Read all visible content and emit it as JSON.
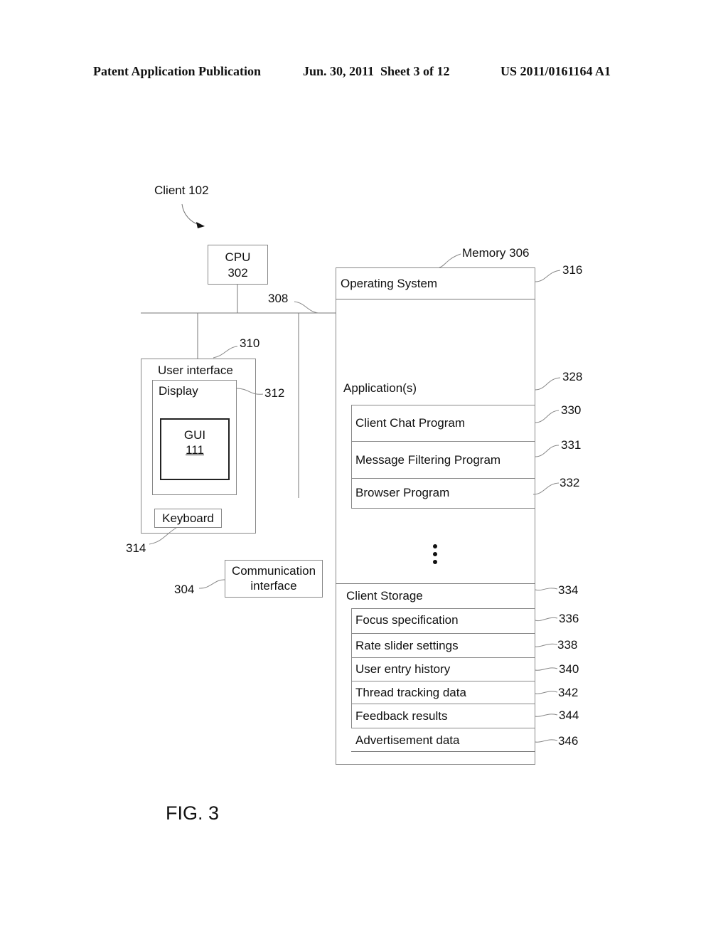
{
  "header": {
    "publication": "Patent Application Publication",
    "date_sheet": "Jun. 30, 2011  Sheet 3 of 12",
    "number": "US 2011/0161164 A1"
  },
  "client_label": "Client 102",
  "cpu": {
    "line1": "CPU",
    "line2": "302"
  },
  "bus_ref": "308",
  "user_interface": {
    "ref": "310",
    "label": "User interface",
    "display": {
      "label": "Display",
      "ref": "312"
    },
    "gui": {
      "label": "GUI",
      "ref": "111"
    },
    "keyboard": {
      "label": "Keyboard",
      "ref": "314"
    }
  },
  "communication_interface": {
    "line1": "Communication",
    "line2": "interface",
    "ref": "304"
  },
  "memory": {
    "label": "Memory 306",
    "operating_system": {
      "label": "Operating System",
      "ref": "316"
    },
    "applications": {
      "label": "Application(s)",
      "ref": "328"
    },
    "programs": [
      {
        "label": "Client Chat Program",
        "ref": "330"
      },
      {
        "label": "Message Filtering Program",
        "ref": "331"
      },
      {
        "label": "Browser Program",
        "ref": "332"
      }
    ],
    "client_storage": {
      "label": "Client Storage",
      "ref": "334"
    },
    "storage_items": [
      {
        "label": "Focus specification",
        "ref": "336"
      },
      {
        "label": "Rate slider settings",
        "ref": "338"
      },
      {
        "label": "User entry history",
        "ref": "340"
      },
      {
        "label": "Thread tracking data",
        "ref": "342"
      },
      {
        "label": "Feedback results",
        "ref": "344"
      },
      {
        "label": "Advertisement data",
        "ref": "346"
      }
    ]
  },
  "figure_label": "FIG. 3"
}
